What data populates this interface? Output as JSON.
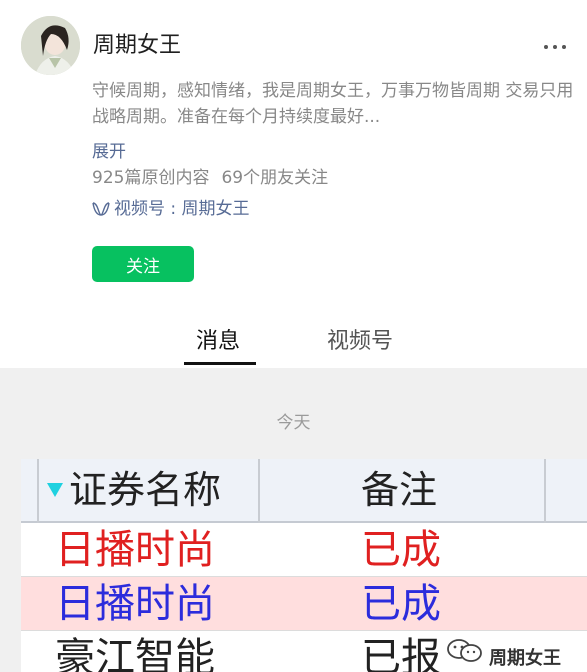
{
  "account": {
    "name": "周期女王",
    "description": "守候周期，感知情绪，我是周期女王，万事万物皆周期 交易只用战略周期。准备在每个月持续度最好...",
    "expand_label": "展开",
    "original_count": "925篇原创内容",
    "friends_follow": "69个朋友关注",
    "channel_label": "视频号 : 周期女王",
    "follow_label": "关注"
  },
  "tabs": [
    {
      "label": "消息",
      "active": true
    },
    {
      "label": "视频号",
      "active": false
    }
  ],
  "feed": {
    "date_label": "今天",
    "table": {
      "headers": [
        "证券名称",
        "备注"
      ],
      "rows": [
        {
          "name": "日播时尚",
          "note": "已成",
          "color": "#e02020"
        },
        {
          "name": "日播时尚",
          "note": "已成",
          "color": "#2c2cdc"
        },
        {
          "name": "豪江智能",
          "note": "已报",
          "color": "#222222"
        }
      ]
    },
    "watermark": "周期女王"
  },
  "colors": {
    "accent_green": "#07c160",
    "link_blue": "#576b95",
    "highlight_row": "#ffdede"
  }
}
